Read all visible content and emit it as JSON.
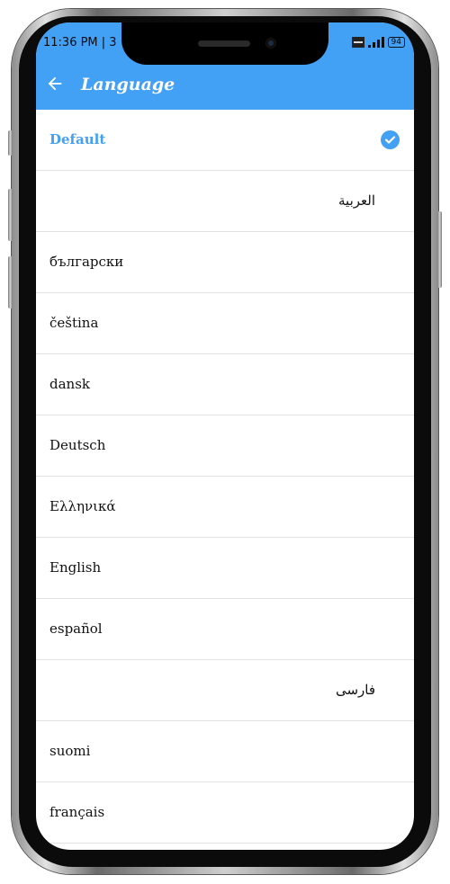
{
  "status_bar": {
    "time": "11:36 PM | 3",
    "battery": "94"
  },
  "app_bar": {
    "title": "Language"
  },
  "colors": {
    "accent": "#42a0f5",
    "divider": "#e3e3e3"
  },
  "languages": [
    {
      "label": "Default",
      "selected": true,
      "rtl": false
    },
    {
      "label": "العربية",
      "selected": false,
      "rtl": true
    },
    {
      "label": "български",
      "selected": false,
      "rtl": false
    },
    {
      "label": "čeština",
      "selected": false,
      "rtl": false
    },
    {
      "label": "dansk",
      "selected": false,
      "rtl": false
    },
    {
      "label": "Deutsch",
      "selected": false,
      "rtl": false
    },
    {
      "label": "Ελληνικά",
      "selected": false,
      "rtl": false
    },
    {
      "label": "English",
      "selected": false,
      "rtl": false
    },
    {
      "label": "español",
      "selected": false,
      "rtl": false
    },
    {
      "label": "فارسی",
      "selected": false,
      "rtl": true
    },
    {
      "label": "suomi",
      "selected": false,
      "rtl": false
    },
    {
      "label": "français",
      "selected": false,
      "rtl": false
    }
  ]
}
